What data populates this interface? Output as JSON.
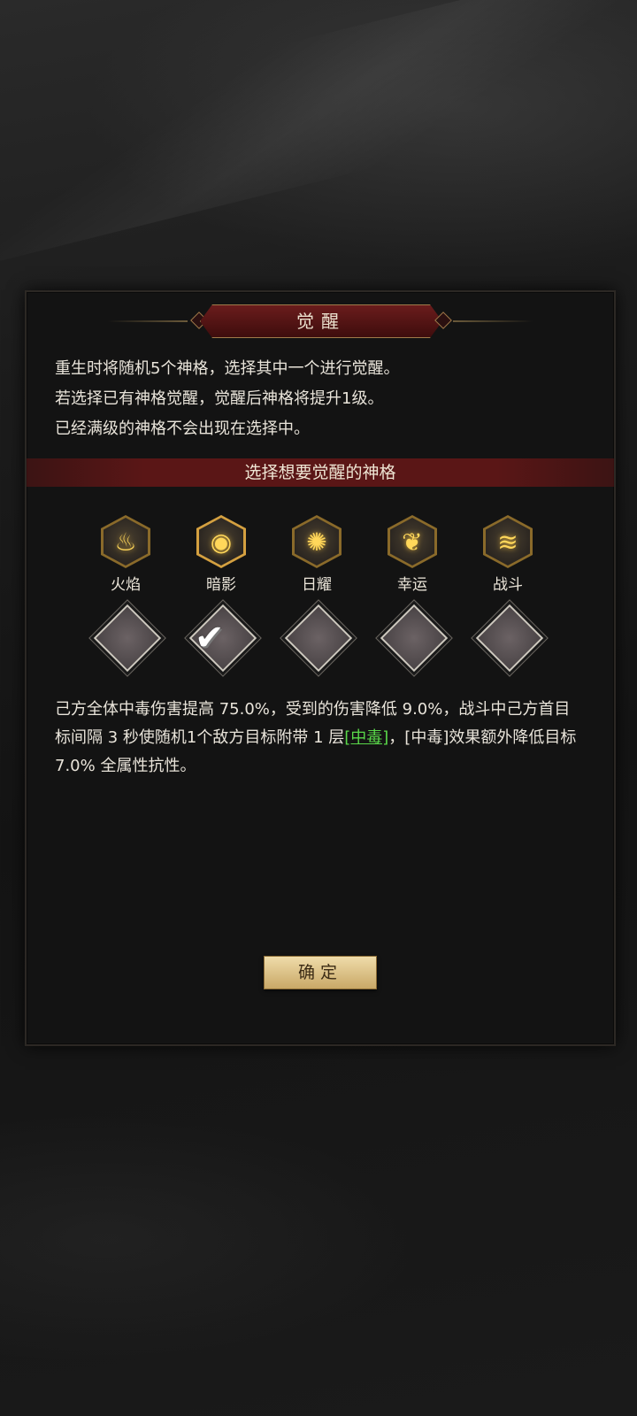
{
  "dialog": {
    "title": "觉醒",
    "description_lines": [
      "重生时将随机5个神格，选择其中一个进行觉醒。",
      "若选择已有神格觉醒，觉醒后神格将提升1级。",
      "已经满级的神格不会出现在选择中。"
    ],
    "section_title": "选择想要觉醒的神格",
    "options": [
      {
        "label": "火焰",
        "icon": "flame-icon",
        "glyph": "♨",
        "selected": false
      },
      {
        "label": "暗影",
        "icon": "shadow-icon",
        "glyph": "◉",
        "selected": true
      },
      {
        "label": "日耀",
        "icon": "sun-icon",
        "glyph": "✺",
        "selected": false
      },
      {
        "label": "幸运",
        "icon": "wing-icon",
        "glyph": "❦",
        "selected": false
      },
      {
        "label": "战斗",
        "icon": "battle-icon",
        "glyph": "≋",
        "selected": false
      }
    ],
    "check_glyph": "✔",
    "effect": {
      "part1": "己方全体中毒伤害提高 75.0%，受到的伤害降低 9.0%，战斗中己方首目标间隔 3 秒使随机1个敌方目标附带 1 层",
      "link": "[中毒]",
      "part2": "，[中毒]效果额外降低目标 7.0% 全属性抗性。"
    },
    "confirm_label": "确定"
  },
  "colors": {
    "title_plate": "#5a1616",
    "link_green": "#5ad84a",
    "gold": "#d4a040"
  }
}
